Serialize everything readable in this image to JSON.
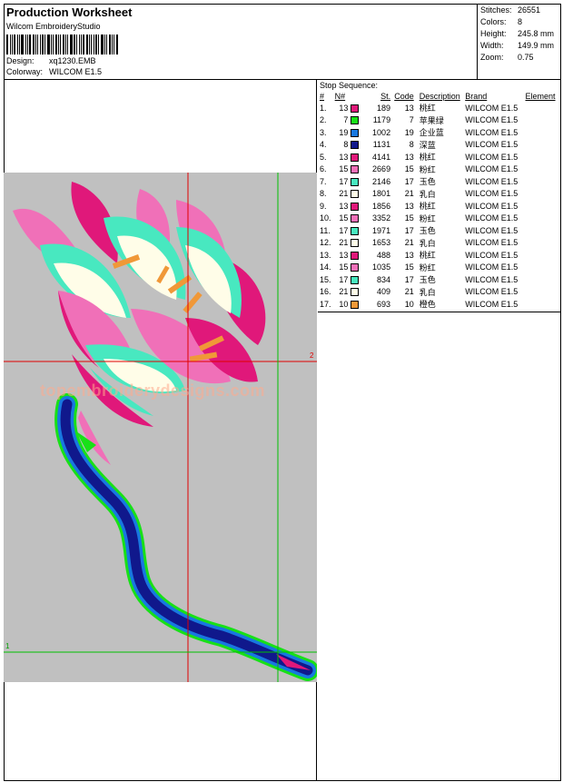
{
  "header": {
    "title": "Production Worksheet",
    "software": "Wilcom EmbroideryStudio",
    "design_label": "Design:",
    "design_value": "xq1230.EMB",
    "colorway_label": "Colorway:",
    "colorway_value": "WILCOM E1.5"
  },
  "stats": {
    "stitches_label": "Stitches:",
    "stitches_value": "26551",
    "colors_label": "Colors:",
    "colors_value": "8",
    "height_label": "Height:",
    "height_value": "245.8 mm",
    "width_label": "Width:",
    "width_value": "149.9 mm",
    "zoom_label": "Zoom:",
    "zoom_value": "0.75"
  },
  "watermark": "topembroiderydesigns.com",
  "guides": {
    "label_1": "1",
    "label_2": "2"
  },
  "stop_sequence": {
    "title": "Stop Sequence:",
    "columns": {
      "idx": "#",
      "needle": "N#",
      "stitches": "St.",
      "code": "Code",
      "description": "Description",
      "brand": "Brand",
      "element": "Element"
    },
    "rows": [
      {
        "idx": "1.",
        "n": "13",
        "color": "#e0187a",
        "st": "189",
        "code": "13",
        "desc": "桃红",
        "brand": "WILCOM E1.5"
      },
      {
        "idx": "2.",
        "n": "7",
        "color": "#18e018",
        "st": "1179",
        "code": "7",
        "desc": "苹果绿",
        "brand": "WILCOM E1.5"
      },
      {
        "idx": "3.",
        "n": "19",
        "color": "#1878e0",
        "st": "1002",
        "code": "19",
        "desc": "企业蓝",
        "brand": "WILCOM E1.5"
      },
      {
        "idx": "4.",
        "n": "8",
        "color": "#10188c",
        "st": "1131",
        "code": "8",
        "desc": "深蓝",
        "brand": "WILCOM E1.5"
      },
      {
        "idx": "5.",
        "n": "13",
        "color": "#e0187a",
        "st": "4141",
        "code": "13",
        "desc": "桃红",
        "brand": "WILCOM E1.5"
      },
      {
        "idx": "6.",
        "n": "15",
        "color": "#f070b8",
        "st": "2669",
        "code": "15",
        "desc": "粉红",
        "brand": "WILCOM E1.5"
      },
      {
        "idx": "7.",
        "n": "17",
        "color": "#48e8c0",
        "st": "2146",
        "code": "17",
        "desc": "玉色",
        "brand": "WILCOM E1.5"
      },
      {
        "idx": "8.",
        "n": "21",
        "color": "#fffde8",
        "st": "1801",
        "code": "21",
        "desc": "乳白",
        "brand": "WILCOM E1.5"
      },
      {
        "idx": "9.",
        "n": "13",
        "color": "#e0187a",
        "st": "1856",
        "code": "13",
        "desc": "桃红",
        "brand": "WILCOM E1.5"
      },
      {
        "idx": "10.",
        "n": "15",
        "color": "#f070b8",
        "st": "3352",
        "code": "15",
        "desc": "粉红",
        "brand": "WILCOM E1.5"
      },
      {
        "idx": "11.",
        "n": "17",
        "color": "#48e8c0",
        "st": "1971",
        "code": "17",
        "desc": "玉色",
        "brand": "WILCOM E1.5"
      },
      {
        "idx": "12.",
        "n": "21",
        "color": "#fffde8",
        "st": "1653",
        "code": "21",
        "desc": "乳白",
        "brand": "WILCOM E1.5"
      },
      {
        "idx": "13.",
        "n": "13",
        "color": "#e0187a",
        "st": "488",
        "code": "13",
        "desc": "桃红",
        "brand": "WILCOM E1.5"
      },
      {
        "idx": "14.",
        "n": "15",
        "color": "#f070b8",
        "st": "1035",
        "code": "15",
        "desc": "粉红",
        "brand": "WILCOM E1.5"
      },
      {
        "idx": "15.",
        "n": "17",
        "color": "#48e8c0",
        "st": "834",
        "code": "17",
        "desc": "玉色",
        "brand": "WILCOM E1.5"
      },
      {
        "idx": "16.",
        "n": "21",
        "color": "#fffde8",
        "st": "409",
        "code": "21",
        "desc": "乳白",
        "brand": "WILCOM E1.5"
      },
      {
        "idx": "17.",
        "n": "10",
        "color": "#f09838",
        "st": "693",
        "code": "10",
        "desc": "橙色",
        "brand": "WILCOM E1.5"
      }
    ]
  }
}
